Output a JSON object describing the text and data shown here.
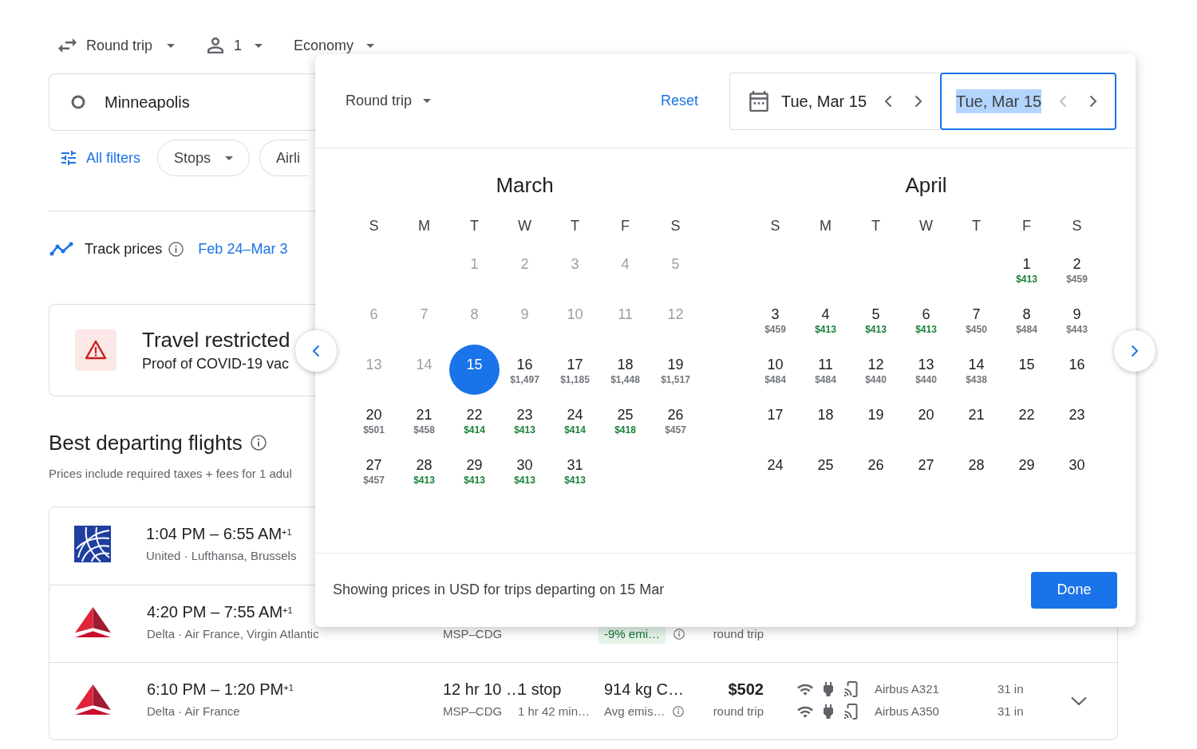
{
  "top_bar": {
    "trip_type": "Round trip",
    "passengers": "1",
    "cabin": "Economy"
  },
  "search": {
    "origin": "Minneapolis"
  },
  "filters": {
    "all_filters": "All filters",
    "chips": [
      {
        "label": "Stops",
        "dropdown": true
      },
      {
        "label": "Airli"
      }
    ]
  },
  "track_prices": {
    "label": "Track prices",
    "dates": "Feb 24–Mar 3"
  },
  "restriction_card": {
    "title": "Travel restricted",
    "text": "Proof of COVID-19 vac"
  },
  "best_flights": {
    "title": "Best departing flights",
    "subtitle": "Prices include required taxes + fees for 1 adul",
    "flights": [
      {
        "logo": {
          "kind": "globe"
        },
        "times": "1:04 PM – 6:55 AM$^{+1}$",
        "airlines": "United · Lufthansa, Brussels"
      },
      {
        "logo": {
          "kind": "triangle"
        },
        "times": "4:20 PM – 7:55 AM$^{+1}$",
        "airlines": "Delta · Air France, Virgin Atlantic",
        "route": "MSP–CDG",
        "emissions_note": {
          "text": "-9% emi…",
          "kind": "badge"
        },
        "price_note": "round trip"
      },
      {
        "logo": {
          "kind": "triangle"
        },
        "times": "6:10 PM – 1:20 PM$^{+1}$",
        "airlines": "Delta · Air France",
        "duration": "12 hr 10 …",
        "stops": "1 stop",
        "route": "MSP–CDG",
        "layover": "1 hr 42 min…",
        "emissions": "914 kg C…",
        "emissions_note": {
          "text": "Avg emis…",
          "kind": "plain"
        },
        "price": "$502",
        "price_note": "round trip",
        "aircraft": [
          {
            "model": "Airbus A321",
            "legroom": "31 in"
          },
          {
            "model": "Airbus A350",
            "legroom": "31 in"
          }
        ],
        "expandable": true
      }
    ]
  },
  "date_picker": {
    "trip_type": "Round trip",
    "reset": "Reset",
    "departure": {
      "value": "Tue, Mar 15",
      "focused": false,
      "highlighted": false,
      "prev_disabled": false
    },
    "return": {
      "value": "Tue, Mar 15",
      "focused": true,
      "highlighted": true,
      "prev_disabled": true
    },
    "months": [
      {
        "title": "March",
        "weekdays": [
          "S",
          "M",
          "T",
          "W",
          "T",
          "F",
          "S"
        ],
        "weeks": [
          [
            {
              "day": "1",
              "selected": false,
              "disabled": true
            },
            {
              "day": "2",
              "selected": false,
              "disabled": true
            },
            {
              "day": "3",
              "selected": false,
              "disabled": true
            },
            {
              "day": "4",
              "selected": false,
              "disabled": true
            },
            {
              "day": "5",
              "selected": false,
              "disabled": true
            }
          ],
          [
            {
              "day": "6",
              "selected": false,
              "disabled": true
            },
            {
              "day": "7",
              "selected": false,
              "disabled": true
            },
            {
              "day": "8",
              "selected": false,
              "disabled": true
            },
            {
              "day": "9",
              "selected": false,
              "disabled": true
            },
            {
              "day": "10",
              "selected": false,
              "disabled": true
            },
            {
              "day": "11",
              "selected": false,
              "disabled": true
            },
            {
              "day": "12",
              "selected": false,
              "disabled": true
            }
          ],
          [
            {
              "day": "13",
              "selected": false,
              "disabled": true
            },
            {
              "day": "14",
              "selected": false,
              "disabled": true
            },
            {
              "day": "15",
              "selected": true,
              "disabled": false
            },
            {
              "day": "16",
              "price": "$1,497",
              "low_price": false,
              "selected": false,
              "disabled": false
            },
            {
              "day": "17",
              "price": "$1,185",
              "low_price": false,
              "selected": false,
              "disabled": false
            },
            {
              "day": "18",
              "price": "$1,448",
              "low_price": false,
              "selected": false,
              "disabled": false
            },
            {
              "day": "19",
              "price": "$1,517",
              "low_price": false,
              "selected": false,
              "disabled": false
            }
          ],
          [
            {
              "day": "20",
              "price": "$501",
              "low_price": false,
              "selected": false,
              "disabled": false
            },
            {
              "day": "21",
              "price": "$458",
              "low_price": false,
              "selected": false,
              "disabled": false
            },
            {
              "day": "22",
              "price": "$414",
              "low_price": true,
              "selected": false,
              "disabled": false
            },
            {
              "day": "23",
              "price": "$413",
              "low_price": true,
              "selected": false,
              "disabled": false
            },
            {
              "day": "24",
              "price": "$414",
              "low_price": true,
              "selected": false,
              "disabled": false
            },
            {
              "day": "25",
              "price": "$418",
              "low_price": true,
              "selected": false,
              "disabled": false
            },
            {
              "day": "26",
              "price": "$457",
              "low_price": false,
              "selected": false,
              "disabled": false
            }
          ],
          [
            {
              "day": "27",
              "price": "$457",
              "low_price": false,
              "selected": false,
              "disabled": false
            },
            {
              "day": "28",
              "price": "$413",
              "low_price": true,
              "selected": false,
              "disabled": false
            },
            {
              "day": "29",
              "price": "$413",
              "low_price": true,
              "selected": false,
              "disabled": false
            },
            {
              "day": "30",
              "price": "$413",
              "low_price": true,
              "selected": false,
              "disabled": false
            },
            {
              "day": "31",
              "price": "$413",
              "low_price": true,
              "selected": false,
              "disabled": false
            }
          ]
        ]
      },
      {
        "title": "April",
        "weekdays": [
          "S",
          "M",
          "T",
          "W",
          "T",
          "F",
          "S"
        ],
        "weeks": [
          [
            {
              "day": "1",
              "price": "$413",
              "low_price": true,
              "selected": false,
              "disabled": false
            },
            {
              "day": "2",
              "price": "$459",
              "low_price": false,
              "selected": false,
              "disabled": false
            }
          ],
          [
            {
              "day": "3",
              "price": "$459",
              "low_price": false,
              "selected": false,
              "disabled": false
            },
            {
              "day": "4",
              "price": "$413",
              "low_price": true,
              "selected": false,
              "disabled": false
            },
            {
              "day": "5",
              "price": "$413",
              "low_price": true,
              "selected": false,
              "disabled": false
            },
            {
              "day": "6",
              "price": "$413",
              "low_price": true,
              "selected": false,
              "disabled": false
            },
            {
              "day": "7",
              "price": "$450",
              "low_price": false,
              "selected": false,
              "disabled": false
            },
            {
              "day": "8",
              "price": "$484",
              "low_price": false,
              "selected": false,
              "disabled": false
            },
            {
              "day": "9",
              "price": "$443",
              "low_price": false,
              "selected": false,
              "disabled": false
            }
          ],
          [
            {
              "day": "10",
              "price": "$484",
              "low_price": false,
              "selected": false,
              "disabled": false
            },
            {
              "day": "11",
              "price": "$484",
              "low_price": false,
              "selected": false,
              "disabled": false
            },
            {
              "day": "12",
              "price": "$440",
              "low_price": false,
              "selected": false,
              "disabled": false
            },
            {
              "day": "13",
              "price": "$440",
              "low_price": false,
              "selected": false,
              "disabled": false
            },
            {
              "day": "14",
              "price": "$438",
              "low_price": false,
              "selected": false,
              "disabled": false
            },
            {
              "day": "15",
              "selected": false,
              "disabled": false
            },
            {
              "day": "16",
              "selected": false,
              "disabled": false
            }
          ],
          [
            {
              "day": "17",
              "selected": false,
              "disabled": false
            },
            {
              "day": "18",
              "selected": false,
              "disabled": false
            },
            {
              "day": "19",
              "selected": false,
              "disabled": false
            },
            {
              "day": "20",
              "selected": false,
              "disabled": false
            },
            {
              "day": "21",
              "selected": false,
              "disabled": false
            },
            {
              "day": "22",
              "selected": false,
              "disabled": false
            },
            {
              "day": "23",
              "selected": false,
              "disabled": false
            }
          ],
          [
            {
              "day": "24",
              "selected": false,
              "disabled": false
            },
            {
              "day": "25",
              "selected": false,
              "disabled": false
            },
            {
              "day": "26",
              "selected": false,
              "disabled": false
            },
            {
              "day": "27",
              "selected": false,
              "disabled": false
            },
            {
              "day": "28",
              "selected": false,
              "disabled": false
            },
            {
              "day": "29",
              "selected": false,
              "disabled": false
            },
            {
              "day": "30",
              "selected": false,
              "disabled": false
            }
          ]
        ]
      }
    ],
    "footer_note": "Showing prices in USD for trips departing on 15 Mar",
    "done": "Done"
  }
}
